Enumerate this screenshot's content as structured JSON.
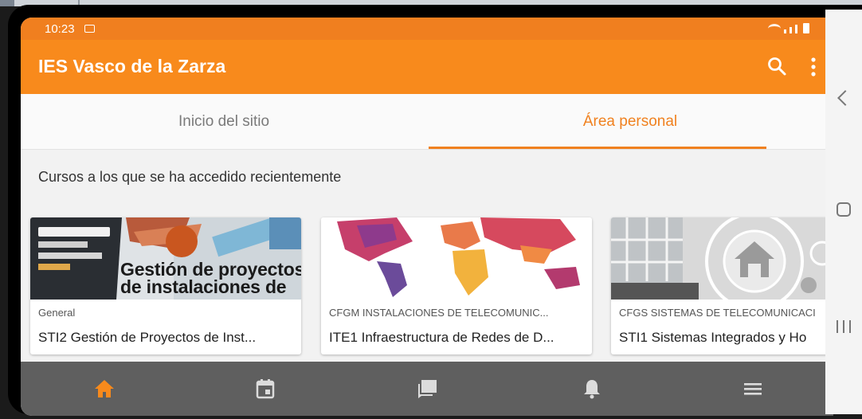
{
  "status_bar": {
    "time": "10:23"
  },
  "app_bar": {
    "title": "IES Vasco de la Zarza"
  },
  "tabs": [
    {
      "label": "Inicio del sitio",
      "active": false
    },
    {
      "label": "Área personal",
      "active": true
    }
  ],
  "section": {
    "title": "Cursos a los que se ha accedido recientemente"
  },
  "courses": [
    {
      "category": "General",
      "name": "STI2 Gestión de Proyectos de Inst...",
      "image_text": [
        "Gestión de proyectos",
        "de instalaciones de"
      ]
    },
    {
      "category": "CFGM INSTALACIONES DE TELECOMUNIC...",
      "name": "ITE1 Infraestructura de Redes de D..."
    },
    {
      "category": "CFGS SISTEMAS DE TELECOMUNICACI",
      "name": "STI1 Sistemas Integrados y Ho"
    }
  ],
  "bottom_nav": [
    {
      "icon": "home-icon",
      "active": true
    },
    {
      "icon": "calendar-icon",
      "active": false
    },
    {
      "icon": "messages-icon",
      "active": false
    },
    {
      "icon": "notifications-icon",
      "active": false
    },
    {
      "icon": "menu-icon",
      "active": false
    }
  ],
  "colors": {
    "accent": "#f88a1c",
    "status_bar": "#f07f1f",
    "active_tab": "#f0811f",
    "bottom_nav_bg": "#5f5f5f"
  }
}
